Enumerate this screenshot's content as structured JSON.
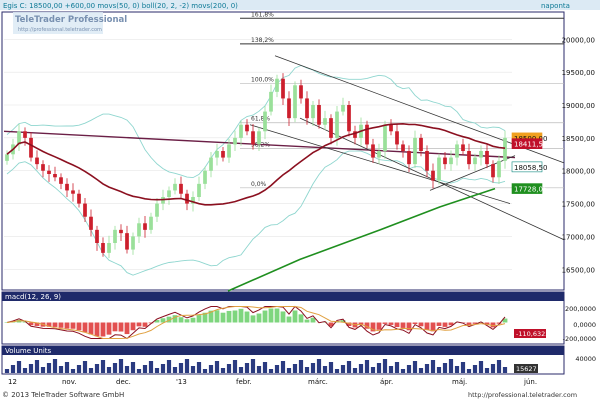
{
  "header": {
    "title_line": "Egis C: 18500,00 +600,00 movs(50, 0) boll(20, 2, -2) movs(200, 0)",
    "period": "naponta"
  },
  "watermark": {
    "brand": "TeleTrader Professional",
    "url": "http://professional.teletrader.com"
  },
  "footer": {
    "copyright": "© 2013 TeleTrader Software GmbH",
    "url": "http://professional.teletrader.com"
  },
  "colors": {
    "background": "#ffffff",
    "title_bar": "#dceaf4",
    "candle_up": "#9ae09a",
    "candle_down": "#cc1f2d",
    "ma50": "#8b1020",
    "ma200": "#1f8f1f",
    "bollinger": "#8fd6cf",
    "resistance_line": "#6b1f46",
    "fib_line": "#bbbbbb",
    "current_price_label": "#f0a020",
    "label_red": "#c0102a",
    "label_teal": "#0e8a80",
    "label_green": "#1f8f1f"
  },
  "chart_data": [
    {
      "type": "candlestick",
      "panel": "price",
      "title": "Egis C",
      "y_ticks": [
        16500,
        17000,
        17500,
        18000,
        18500,
        19000,
        19500,
        20000
      ],
      "y_tick_labels": [
        "16500,00",
        "17000,00",
        "17500,00",
        "18000,00",
        "18500,00",
        "19000,00",
        "19500,00",
        "20000,00"
      ],
      "ylim": [
        16200,
        20400
      ],
      "x_tick_labels": [
        "12",
        "nov.",
        "dec.",
        "'13",
        "febr.",
        "márc.",
        "ápr.",
        "máj.",
        "jún."
      ],
      "fibonacci_levels": [
        {
          "label": "161,8%",
          "value": 20320
        },
        {
          "label": "138,2%",
          "value": 19930
        },
        {
          "label": "100,0%",
          "value": 19330
        },
        {
          "label": "61,8%",
          "value": 18730
        },
        {
          "label": "38,2%",
          "value": 18340
        },
        {
          "label": "0,0%",
          "value": 17740
        }
      ],
      "price_labels": [
        {
          "label": "18500,00",
          "value": 18500,
          "kind": "current"
        },
        {
          "label": "18411,50",
          "value": 18411.5,
          "kind": "ma50"
        },
        {
          "label": "18058,50",
          "value": 18058.5,
          "kind": "bollinger"
        },
        {
          "label": "17728,05",
          "value": 17728.05,
          "kind": "ma200"
        }
      ],
      "close_series": [
        18250,
        18400,
        18600,
        18500,
        18200,
        18100,
        18000,
        17950,
        17900,
        17800,
        17700,
        17650,
        17500,
        17300,
        17100,
        16900,
        16750,
        16900,
        17100,
        17050,
        16800,
        17000,
        17200,
        17100,
        17300,
        17500,
        17600,
        17700,
        17800,
        17650,
        17500,
        17600,
        17800,
        18000,
        18200,
        18300,
        18200,
        18400,
        18500,
        18700,
        18600,
        18400,
        18600,
        18900,
        19200,
        19400,
        19100,
        18800,
        19300,
        19100,
        18800,
        19000,
        18700,
        18800,
        18500,
        18900,
        19000,
        18600,
        18500,
        18700,
        18400,
        18200,
        18300,
        18700,
        18600,
        18400,
        18300,
        18100,
        18500,
        18300,
        18000,
        17850,
        18200,
        18100,
        18200,
        18400,
        18300,
        18100,
        18200,
        18300,
        18100,
        17900,
        18150,
        18500
      ]
    },
    {
      "type": "line",
      "panel": "macd",
      "title": "macd(12, 26, 9)",
      "y_tick_labels": [
        "200,0000",
        "0,0000",
        "-200,0000"
      ],
      "value_label": "-110,6323",
      "ylim": [
        -300,
        300
      ]
    },
    {
      "type": "bar",
      "panel": "volume",
      "title": "Volume Units",
      "y_tick_labels": [
        "40000"
      ],
      "value_label": "15627"
    }
  ]
}
